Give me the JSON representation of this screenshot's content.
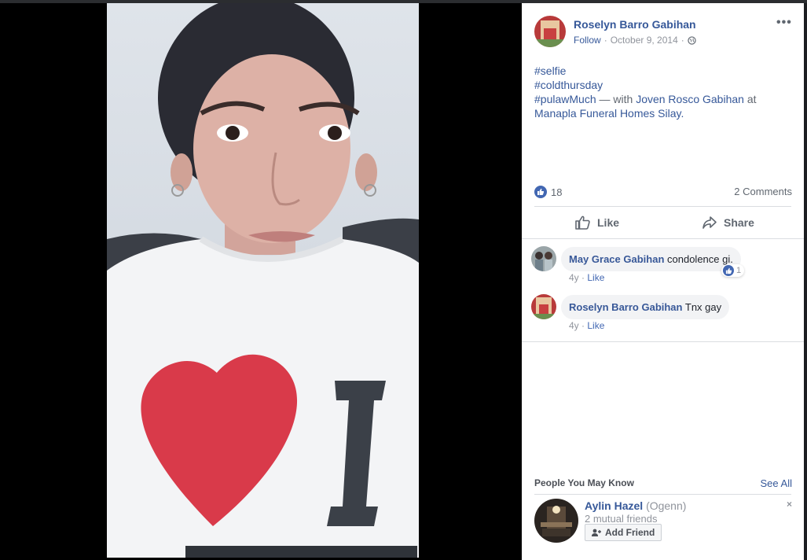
{
  "post": {
    "author": "Roselyn Barro Gabihan",
    "follow_label": "Follow",
    "separator": "·",
    "date": "October 9, 2014",
    "privacy_icon": "globe-icon",
    "more_icon": "more-options-icon",
    "more_label": "•••",
    "lines": [
      "#selfie",
      "#coldthursday"
    ],
    "hashtag3": "#pulawMuch",
    "with_text": "— with",
    "tagged_person": "Joven Rosco Gabihan",
    "at_text": "at",
    "place": "Manapla Funeral Homes Silay",
    "period": "."
  },
  "reactions": {
    "like_count": "18",
    "comments_count": "2 Comments"
  },
  "actions": {
    "like_label": "Like",
    "share_label": "Share"
  },
  "comments": [
    {
      "author": "May Grace Gabihan",
      "text": "condolence gi.",
      "age": "4y",
      "like_label": "Like",
      "reaction_count": "1"
    },
    {
      "author": "Roselyn Barro Gabihan",
      "text": "Tnx gay",
      "age": "4y",
      "like_label": "Like"
    }
  ],
  "pymk": {
    "title": "People You May Know",
    "see_all": "See All",
    "person_name": "Aylin Hazel",
    "person_alt": "(Ogenn)",
    "mutual": "2 mutual friends",
    "add_friend_label": "Add Friend",
    "close_label": "×"
  },
  "colors": {
    "link": "#365899",
    "like_blue": "#4267b2",
    "heart_red": "#d93a4a"
  }
}
